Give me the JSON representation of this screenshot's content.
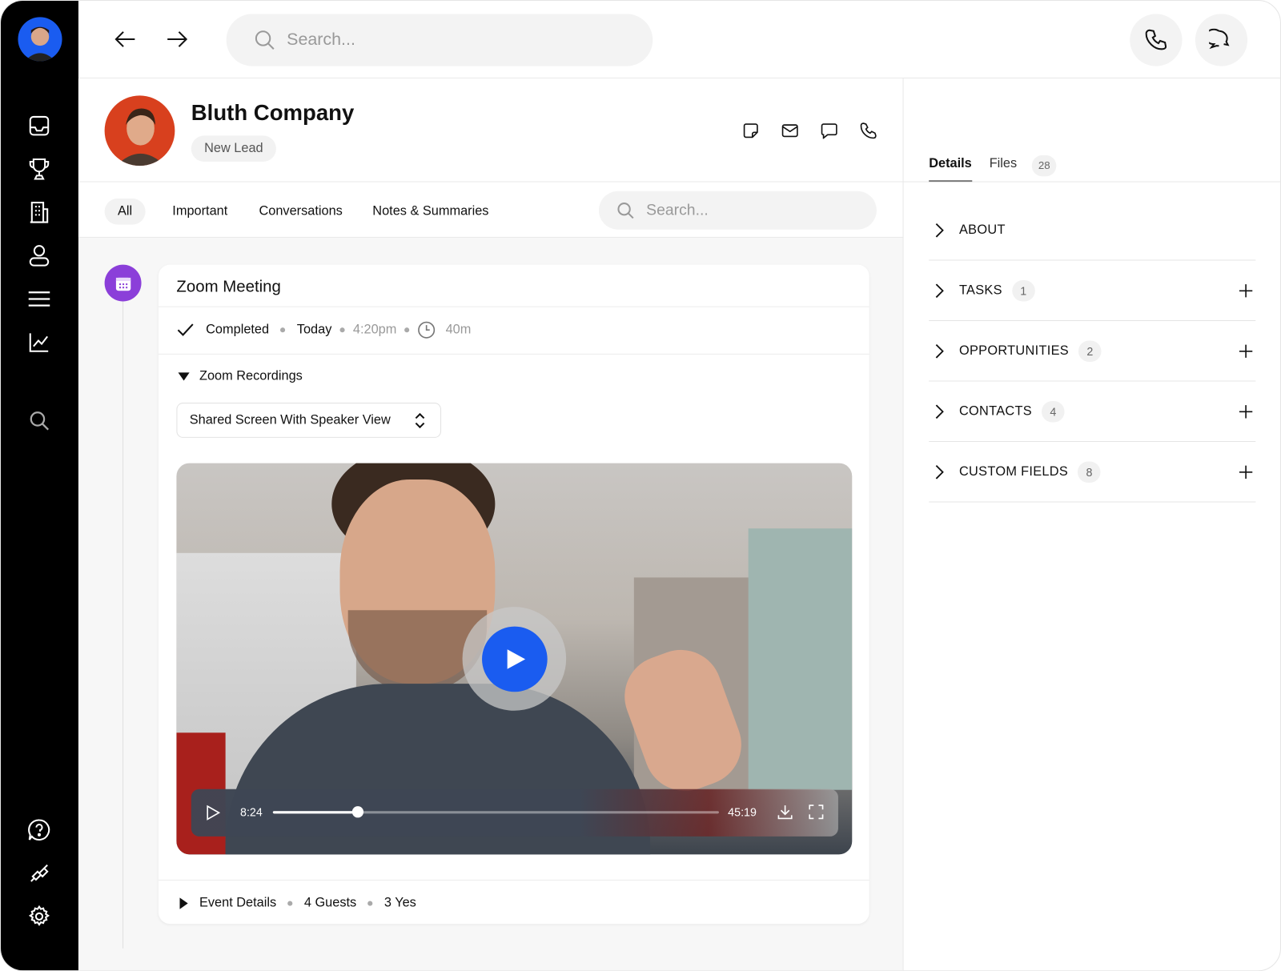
{
  "topbar": {
    "search_placeholder": "Search...",
    "icons": [
      "arrow-left",
      "arrow-right",
      "search",
      "phone",
      "chat"
    ]
  },
  "sidebar": {
    "icons": [
      "inbox",
      "trophy",
      "building",
      "user",
      "list",
      "chart",
      "search",
      "help",
      "plug",
      "gear"
    ]
  },
  "company": {
    "name": "Bluth Company",
    "status": "New Lead",
    "actions": [
      "note",
      "email",
      "message",
      "phone"
    ]
  },
  "filters": {
    "tabs": [
      {
        "label": "All",
        "active": true
      },
      {
        "label": "Important"
      },
      {
        "label": "Conversations"
      },
      {
        "label": "Notes & Summaries"
      }
    ],
    "search_placeholder": "Search..."
  },
  "activity": {
    "title": "Zoom Meeting",
    "status": "Completed",
    "day": "Today",
    "time": "4:20pm",
    "duration": "40m",
    "recordings_label": "Zoom Recordings",
    "view_select": "Shared Screen With Speaker View",
    "player": {
      "current": "8:24",
      "total": "45:19",
      "progress": 0.19
    },
    "event_details": "Event Details",
    "guests": "4 Guests",
    "yes": "3 Yes",
    "accent": "#8b3fd9"
  },
  "right": {
    "tabs": [
      {
        "label": "Details",
        "active": true
      },
      {
        "label": "Files",
        "count": "28"
      }
    ],
    "sections": [
      {
        "label": "ABOUT"
      },
      {
        "label": "TASKS",
        "count": "1"
      },
      {
        "label": "OPPORTUNITIES",
        "count": "2"
      },
      {
        "label": "CONTACTS",
        "count": "4"
      },
      {
        "label": "CUSTOM FIELDS",
        "count": "8"
      }
    ]
  },
  "colors": {
    "play": "#1a5cf0",
    "sidebar": "#000000"
  }
}
